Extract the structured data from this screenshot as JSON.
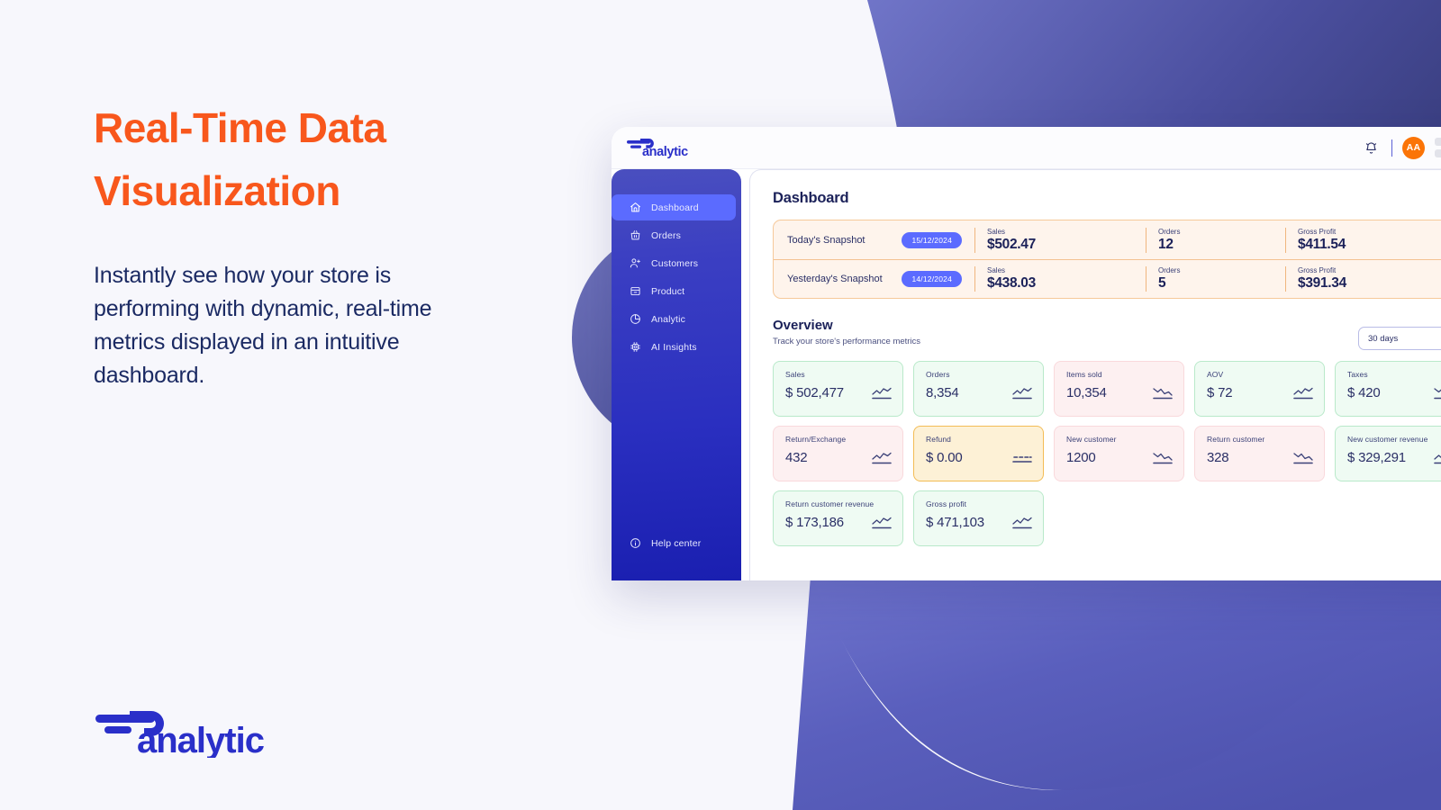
{
  "promo": {
    "title_line1": "Real-Time Data",
    "title_line2": "Visualization",
    "subtitle": "Instantly see how your store is performing with dynamic, real-time metrics displayed in an intuitive dashboard.",
    "accent_color": "#f8571c",
    "text_color": "#1b2a63"
  },
  "brand": {
    "name": "analytic",
    "color": "#2a2fc9"
  },
  "app": {
    "logo_text": "analytic",
    "topbar": {
      "bell_icon": "bell-icon",
      "avatar_initials": "AA",
      "avatar_color": "#fb7407"
    },
    "sidebar": {
      "items": [
        {
          "label": "Dashboard",
          "icon": "home-icon",
          "active": true
        },
        {
          "label": "Orders",
          "icon": "basket-icon",
          "active": false
        },
        {
          "label": "Customers",
          "icon": "user-add-icon",
          "active": false
        },
        {
          "label": "Product",
          "icon": "box-icon",
          "active": false
        },
        {
          "label": "Analytic",
          "icon": "pie-chart-icon",
          "active": false
        },
        {
          "label": "AI Insights",
          "icon": "chip-icon",
          "active": false
        }
      ],
      "help": {
        "label": "Help center",
        "icon": "info-icon"
      }
    },
    "page_title": "Dashboard",
    "snapshots": [
      {
        "label": "Today's Snapshot",
        "date": "15/12/2024",
        "metrics": [
          {
            "label": "Sales",
            "value": "$502.47"
          },
          {
            "label": "Orders",
            "value": "12"
          },
          {
            "label": "Gross Profit",
            "value": "$411.54"
          }
        ]
      },
      {
        "label": "Yesterday's Snapshot",
        "date": "14/12/2024",
        "metrics": [
          {
            "label": "Sales",
            "value": "$438.03"
          },
          {
            "label": "Orders",
            "value": "5"
          },
          {
            "label": "Gross Profit",
            "value": "$391.34"
          }
        ]
      }
    ],
    "overview": {
      "title": "Overview",
      "subtitle": "Track your store's performance metrics",
      "range_value": "30 days",
      "range_icon": "calendar-icon",
      "cards": [
        {
          "label": "Sales",
          "value": "$ 502,477",
          "tone": "green",
          "trend": "up"
        },
        {
          "label": "Orders",
          "value": "8,354",
          "tone": "green",
          "trend": "up"
        },
        {
          "label": "Items sold",
          "value": "10,354",
          "tone": "red",
          "trend": "down"
        },
        {
          "label": "AOV",
          "value": "$ 72",
          "tone": "green",
          "trend": "up"
        },
        {
          "label": "Taxes",
          "value": "$ 420",
          "tone": "green",
          "trend": "down"
        },
        {
          "label": "Return/Exchange",
          "value": "432",
          "tone": "red",
          "trend": "up"
        },
        {
          "label": "Refund",
          "value": "$ 0.00",
          "tone": "amber",
          "trend": "flat"
        },
        {
          "label": "New customer",
          "value": "1200",
          "tone": "red",
          "trend": "down"
        },
        {
          "label": "Return customer",
          "value": "328",
          "tone": "red",
          "trend": "down"
        },
        {
          "label": "New customer revenue",
          "value": "$ 329,291",
          "tone": "green",
          "trend": "up"
        },
        {
          "label": "Return customer revenue",
          "value": "$ 173,186",
          "tone": "green",
          "trend": "up"
        },
        {
          "label": "Gross profit",
          "value": "$ 471,103",
          "tone": "green",
          "trend": "up"
        }
      ]
    }
  },
  "colors": {
    "page_bg": "#f7f7fc",
    "blob_purple": "#5a5fb5",
    "sidebar_top": "#4a4fbf",
    "sidebar_bottom": "#1a1fb0",
    "active_nav": "#5b6bff",
    "snapshot_bg": "#fef4ec",
    "snapshot_border": "#f6c99a",
    "green_card": "#effbf3",
    "red_card": "#fdf0f1",
    "amber_card": "#fdf1d6"
  }
}
